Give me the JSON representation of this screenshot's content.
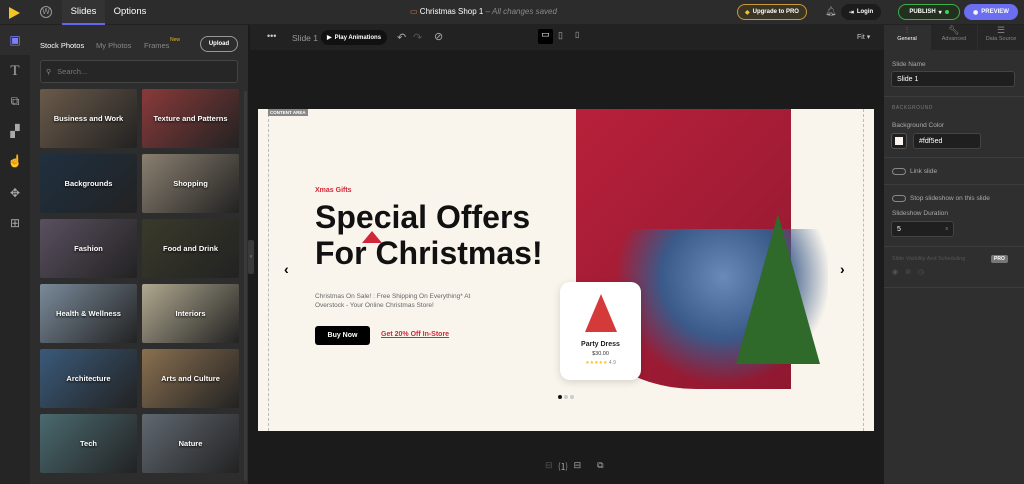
{
  "topbar": {
    "tabs": [
      "Slides",
      "Options"
    ],
    "project_title": "Christmas Shop 1",
    "save_status": "– All changes saved",
    "upgrade": "Upgrade to PRO",
    "login": "Login",
    "publish": "PUBLISH",
    "preview": "PREVIEW"
  },
  "panel": {
    "tabs": [
      "Stock Photos",
      "My Photos",
      "Frames"
    ],
    "new_badge": "New",
    "upload": "Upload",
    "search_placeholder": "Search...",
    "categories": [
      "Business and Work",
      "Texture and Patterns",
      "Backgrounds",
      "Shopping",
      "Fashion",
      "Food and Drink",
      "Health & Wellness",
      "Interiors",
      "Architecture",
      "Arts and Culture",
      "Tech",
      "Nature"
    ],
    "colors": [
      "#6a5a4a",
      "#8a3a3a",
      "#1f3040",
      "#8a8070",
      "#5a5060",
      "#3a3a2a",
      "#7a8a9a",
      "#b0a890",
      "#3a5a7a",
      "#8a7050",
      "#4a6a70",
      "#606870"
    ]
  },
  "canvas": {
    "slide_label": "Slide 1",
    "play": "Play Animations",
    "fit": "Fit"
  },
  "slide": {
    "content_area": "CONTENT AREA",
    "kicker": "Xmas Gifts",
    "headline1": "Special Offers",
    "headline2": "For Christmas!",
    "body": "Christmas On Sale! : Free Shipping On Everything* At Overstock - Your Online Christmas Store!",
    "buy": "Buy Now",
    "offer": "Get 20% Off In-Store",
    "card_title": "Party Dress",
    "card_price": "$30.00",
    "card_rating": "4.9",
    "stars": "★★★★★"
  },
  "right": {
    "tabs": [
      "General",
      "Advanced",
      "Data Source"
    ],
    "slide_name_label": "Slide Name",
    "slide_name": "Slide 1",
    "background_heading": "BACKGROUND",
    "bg_color_label": "Background Color",
    "bg_color": "#fdf5ed",
    "link_slide": "Link slide",
    "stop_slideshow": "Stop slideshow on this slide",
    "duration_label": "Slideshow Duration",
    "duration": "5",
    "duration_unit": "s",
    "visibility": "Slide Visibility And Scheduling",
    "pro": "PRO"
  }
}
